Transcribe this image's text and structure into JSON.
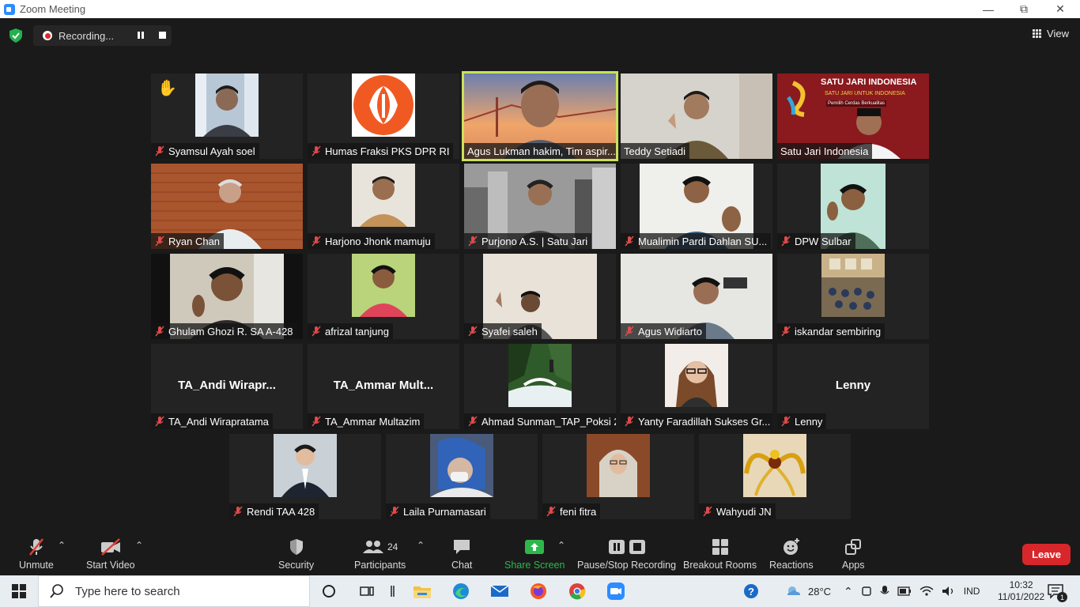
{
  "window": {
    "title": "Zoom Meeting"
  },
  "recording": {
    "label": "Recording..."
  },
  "view": {
    "label": "View"
  },
  "tiles": [
    {
      "name": "Syamsul Ayah soel",
      "hand": "✋"
    },
    {
      "name": "Humas Fraksi PKS DPR RI"
    },
    {
      "name": "Agus Lukman hakim, Tim aspir..."
    },
    {
      "name": "Teddy Setiadi"
    },
    {
      "name": "Satu Jari Indonesia",
      "banner_title": "SATU JARI INDONESIA",
      "banner_sub": "SATU JARI UNTUK INDONESIA",
      "banner_tag": "Pemilih Cerdas Berkualitas"
    },
    {
      "name": "Ryan Chan"
    },
    {
      "name": "Harjono Jhonk mamuju"
    },
    {
      "name": "Purjono A.S. | Satu Jari"
    },
    {
      "name": "Mualimin Pardi Dahlan SU..."
    },
    {
      "name": "DPW Sulbar"
    },
    {
      "name": "Ghulam Ghozi R. SA A-428"
    },
    {
      "name": "afrizal tanjung"
    },
    {
      "name": "Syafei saleh"
    },
    {
      "name": "Agus Widiarto"
    },
    {
      "name": "iskandar sembiring"
    },
    {
      "name": "TA_Andi Wirapratama",
      "display": "TA_Andi  Wirapr..."
    },
    {
      "name": "TA_Ammar Multazim",
      "display": "TA_Ammar  Mult..."
    },
    {
      "name": "Ahmad Sunman_TAP_Poksi 2"
    },
    {
      "name": "Yanty Faradillah Sukses Gr..."
    },
    {
      "name": "Lenny",
      "display": "Lenny"
    },
    {
      "name": "Rendi TAA 428"
    },
    {
      "name": "Laila Purnamasari"
    },
    {
      "name": "feni fitra"
    },
    {
      "name": "Wahyudi JN"
    }
  ],
  "toolbar": {
    "unmute": "Unmute",
    "start_video": "Start Video",
    "security": "Security",
    "participants": "Participants",
    "participants_count": "24",
    "chat": "Chat",
    "share_screen": "Share Screen",
    "pause_stop": "Pause/Stop Recording",
    "breakout": "Breakout Rooms",
    "reactions": "Reactions",
    "apps": "Apps",
    "leave": "Leave"
  },
  "taskbar": {
    "search_placeholder": "Type here to search",
    "temperature": "28°C",
    "language": "IND",
    "time": "10:32",
    "date": "11/01/2022",
    "notif_count": "1"
  },
  "colors": {
    "share_green": "#2eb84b",
    "leave_red": "#d8272b",
    "active_border": "#c9e25a",
    "zoom_blue": "#2d8cff"
  }
}
